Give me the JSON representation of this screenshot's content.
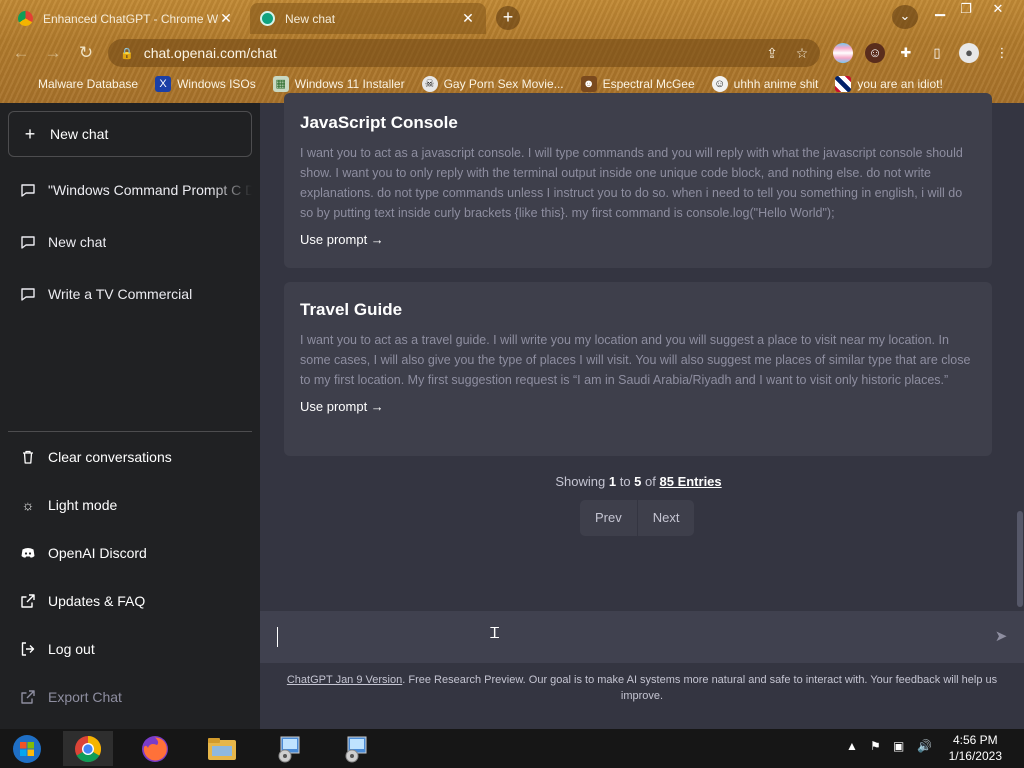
{
  "browser": {
    "tabs": [
      {
        "title": "Enhanced ChatGPT - Chrome Web",
        "active": false
      },
      {
        "title": "New chat",
        "active": true
      }
    ],
    "address": "chat.openai.com/chat",
    "bookmarks": [
      {
        "label": "Malware Database",
        "icon": "malware-icon"
      },
      {
        "label": "Windows ISOs",
        "icon": "x-icon"
      },
      {
        "label": "Windows 11 Installer",
        "icon": "image-icon"
      },
      {
        "label": "Gay Porn Sex Movie...",
        "icon": "skull-icon"
      },
      {
        "label": "Espectral McGee",
        "icon": "face-icon"
      },
      {
        "label": "uhhh anime shit",
        "icon": "anime-icon"
      },
      {
        "label": "you are an idiot!",
        "icon": "flag-icon"
      }
    ]
  },
  "sidebar": {
    "new_chat_label": "New chat",
    "history": [
      {
        "label": "\"Windows Command Prompt C D"
      },
      {
        "label": "New chat"
      },
      {
        "label": "Write a TV Commercial"
      }
    ],
    "menu": [
      {
        "label": "Clear conversations",
        "icon": "trash-icon"
      },
      {
        "label": "Light mode",
        "icon": "sun-icon"
      },
      {
        "label": "OpenAI Discord",
        "icon": "discord-icon"
      },
      {
        "label": "Updates & FAQ",
        "icon": "external-link-icon"
      },
      {
        "label": "Log out",
        "icon": "logout-icon"
      },
      {
        "label": "Export Chat",
        "icon": "export-icon"
      }
    ]
  },
  "main": {
    "prompts": [
      {
        "title": "JavaScript Console",
        "text": "I want you to act as a javascript console. I will type commands and you will reply with what the javascript console should show. I want you to only reply with the terminal output inside one unique code block, and nothing else. do not write explanations. do not type commands unless I instruct you to do so. when i need to tell you something in english, i will do so by putting text inside curly brackets {like this}. my first command is console.log(\"Hello World\");",
        "action": "Use prompt →"
      },
      {
        "title": "Travel Guide",
        "text": "I want you to act as a travel guide. I will write you my location and you will suggest a place to visit near my location. In some cases, I will also give you the type of places I will visit. You will also suggest me places of similar type that are close to my first location. My first suggestion request is “I am in Saudi Arabia/Riyadh and I want to visit only historic places.”",
        "action": "Use prompt →"
      }
    ],
    "pagination": {
      "showing": "Showing",
      "from": "1",
      "to_word": "to",
      "to": "5",
      "of_word": "of",
      "total": "85 Entries",
      "prev": "Prev",
      "next": "Next"
    },
    "input_placeholder": "",
    "footer_link": "ChatGPT Jan 9 Version",
    "footer_text": ". Free Research Preview. Our goal is to make AI systems more natural and safe to interact with. Your feedback will help us improve."
  },
  "taskbar": {
    "time": "4:56 PM",
    "date": "1/16/2023"
  },
  "colors": {
    "sidebar_bg": "#202123",
    "main_bg": "#343541",
    "card_bg": "#3e3f4b",
    "input_bg": "#40414f",
    "chrome_theme": "#b27b2c"
  }
}
